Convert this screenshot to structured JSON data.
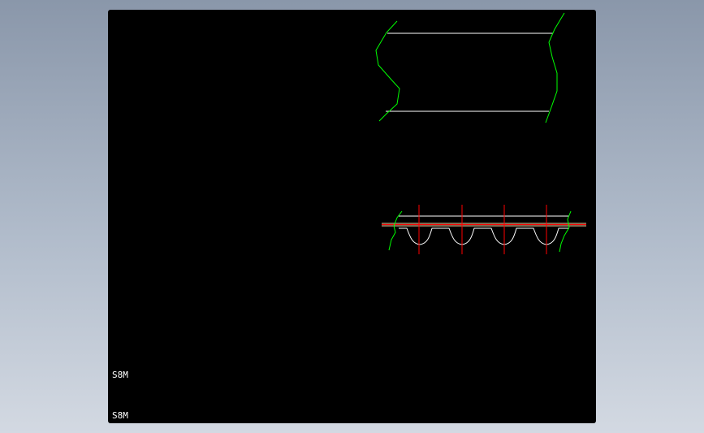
{
  "labels": {
    "upper": "S8M",
    "lower": "S8M"
  },
  "colors": {
    "background_gradient_top": "#8a97aa",
    "background_gradient_bottom": "#d3d9e2",
    "viewport": "#000000",
    "outline": "#ffffff",
    "break_line": "#00ff00",
    "center_line": "#ff0000",
    "pitch_line": "#ffd0a0"
  }
}
